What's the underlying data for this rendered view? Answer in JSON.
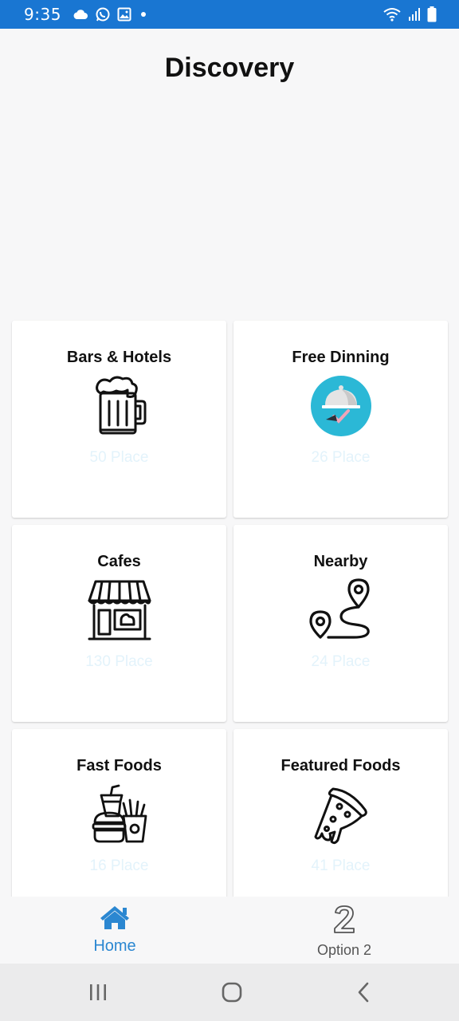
{
  "status_bar": {
    "time": "9:35",
    "left_icons": [
      "cloud-icon",
      "whatsapp-icon",
      "image-icon",
      "dot-icon"
    ],
    "right_icons": [
      "wifi-icon",
      "signal-icon",
      "battery-icon"
    ]
  },
  "header": {
    "title": "Discovery"
  },
  "categories": [
    {
      "title": "Bars & Hotels",
      "count": "50 Place",
      "icon": "beer-mug-icon"
    },
    {
      "title": "Free Dinning",
      "count": "26 Place",
      "icon": "dining-cloche-icon"
    },
    {
      "title": "Cafes",
      "count": "130 Place",
      "icon": "cafe-shop-icon"
    },
    {
      "title": "Nearby",
      "count": "24 Place",
      "icon": "route-pin-icon"
    },
    {
      "title": "Fast Foods",
      "count": "16 Place",
      "icon": "fast-food-icon"
    },
    {
      "title": "Featured Foods",
      "count": "41 Place",
      "icon": "pizza-slice-icon"
    }
  ],
  "tab_bar": {
    "tabs": [
      {
        "label": "Home",
        "icon": "home-icon",
        "active": true
      },
      {
        "label": "Option 2",
        "icon": "number-two-icon",
        "active": false
      }
    ],
    "active_color": "#2b87d1"
  },
  "system_nav": {
    "icons": [
      "recent-apps-icon",
      "home-circle-icon",
      "back-chevron-icon"
    ]
  },
  "colors": {
    "status_bar": "#1976d2",
    "count_text": "#e3f3fb",
    "cloche_bg": "#2bb8d6"
  }
}
